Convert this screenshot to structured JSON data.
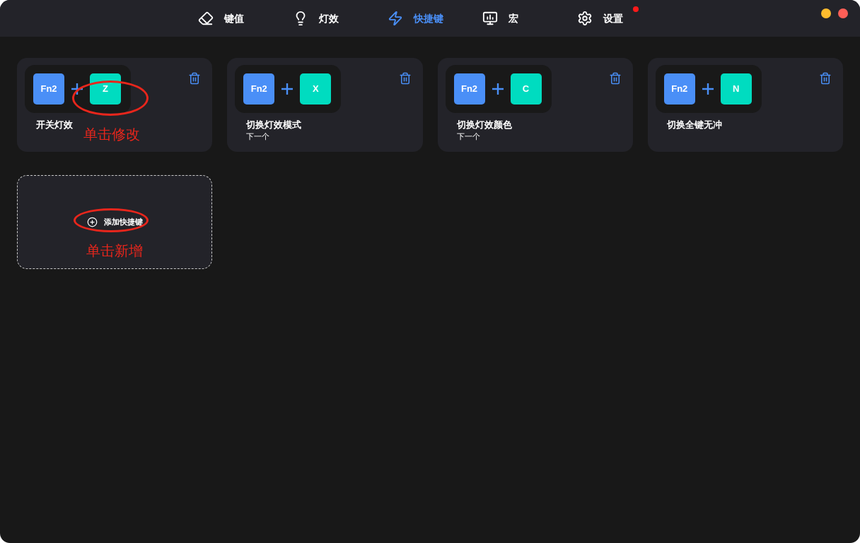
{
  "window": {
    "controls": [
      {
        "kind": "minimize"
      },
      {
        "kind": "close"
      }
    ]
  },
  "nav": [
    {
      "label": "键值",
      "selected": false,
      "badge": false
    },
    {
      "label": "灯效",
      "selected": false,
      "badge": false
    },
    {
      "label": "快捷键",
      "selected": true,
      "badge": false
    },
    {
      "label": "宏",
      "selected": false,
      "badge": false
    },
    {
      "label": "设置",
      "selected": false,
      "badge": true
    }
  ],
  "shortcuts": [
    {
      "keys": [
        {
          "label": "Fn2",
          "kind": "modifier"
        },
        {
          "label": "Z",
          "kind": "key"
        }
      ],
      "title": "开关灯效",
      "annotation": "单击修改"
    },
    {
      "keys": [
        {
          "label": "Fn2",
          "kind": "modifier"
        },
        {
          "label": "X",
          "kind": "key"
        }
      ],
      "title": "切换灯效模式",
      "subtitle": "下一个"
    },
    {
      "keys": [
        {
          "label": "Fn2",
          "kind": "modifier"
        },
        {
          "label": "C",
          "kind": "key"
        }
      ],
      "title": "切换灯效颜色",
      "subtitle": "下一个"
    },
    {
      "keys": [
        {
          "label": "Fn2",
          "kind": "modifier"
        },
        {
          "label": "N",
          "kind": "key"
        }
      ],
      "title": "切换全键无冲"
    }
  ],
  "add_card": {
    "label": "添加快捷键",
    "annotation": "单击新增"
  }
}
